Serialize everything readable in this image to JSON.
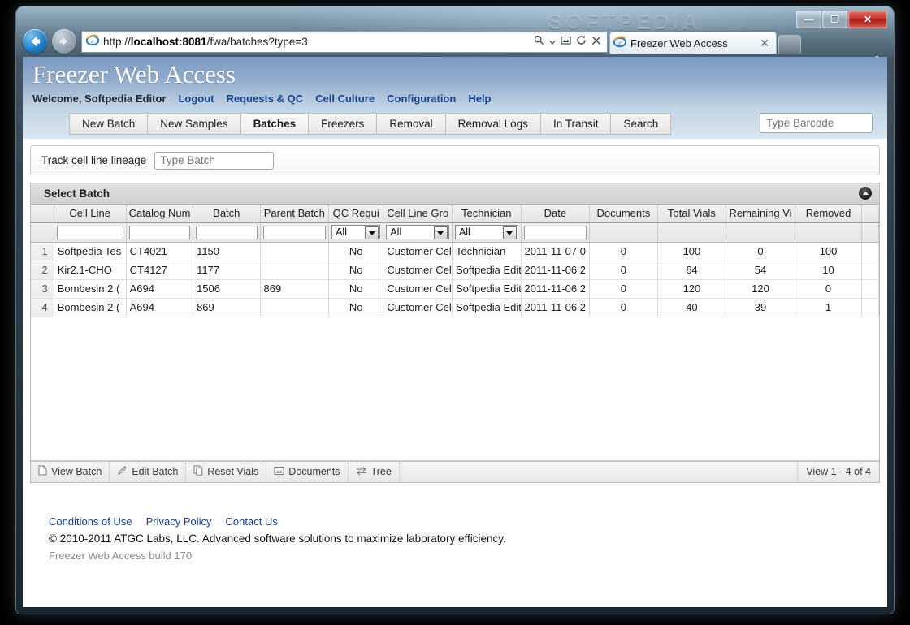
{
  "browser": {
    "url_prefix": "http://",
    "url_host": "localhost:8081",
    "url_path": "/fwa/batches?type=3",
    "watermark": "SOFTPEDIA",
    "tab_title": "Freezer Web Access",
    "tab_close": "✕",
    "minimize": "—",
    "maximize": "❐",
    "close": "✕",
    "icons": {
      "back": "back-arrow-icon",
      "forward": "forward-arrow-icon",
      "ie_logo": "ie-logo-icon",
      "search": "search-icon",
      "dropdown": "chevron-down-icon",
      "compat": "compatibility-view-icon",
      "refresh": "refresh-icon",
      "stop": "stop-icon",
      "home": "home-icon",
      "favorites": "star-icon",
      "tools": "gear-icon"
    }
  },
  "app": {
    "title": "Freezer Web Access",
    "welcome": "Welcome, Softpedia Editor",
    "nav_links": [
      "Logout",
      "Requests & QC",
      "Cell Culture",
      "Configuration",
      "Help"
    ],
    "tabs": [
      {
        "label": "New Batch",
        "active": false
      },
      {
        "label": "New Samples",
        "active": false
      },
      {
        "label": "Batches",
        "active": true
      },
      {
        "label": "Freezers",
        "active": false
      },
      {
        "label": "Removal",
        "active": false
      },
      {
        "label": "Removal Logs",
        "active": false
      },
      {
        "label": "In Transit",
        "active": false
      },
      {
        "label": "Search",
        "active": false
      }
    ],
    "barcode_placeholder": "Type Barcode",
    "lineage_label": "Track cell line lineage",
    "lineage_placeholder": "Type Batch"
  },
  "panel": {
    "title": "Select Batch",
    "collapse_icon": "chevron-up-icon"
  },
  "grid": {
    "columns": [
      "Cell Line",
      "Catalog Num",
      "Batch",
      "Parent Batch",
      "QC Requi",
      "Cell Line Gro",
      "Technician",
      "Date",
      "Documents",
      "Total Vials",
      "Remaining Vi",
      "Removed"
    ],
    "filters": [
      {
        "type": "text",
        "value": ""
      },
      {
        "type": "text",
        "value": ""
      },
      {
        "type": "text",
        "value": ""
      },
      {
        "type": "text",
        "value": ""
      },
      {
        "type": "select",
        "value": "All"
      },
      {
        "type": "select",
        "value": "All"
      },
      {
        "type": "select",
        "value": "All"
      },
      {
        "type": "text",
        "value": ""
      },
      {
        "type": "none",
        "value": ""
      },
      {
        "type": "none",
        "value": ""
      },
      {
        "type": "none",
        "value": ""
      },
      {
        "type": "none",
        "value": ""
      }
    ],
    "rows": [
      {
        "num": "1",
        "cells": [
          "Softpedia Tes",
          "CT4021",
          "1150",
          "",
          "No",
          "Customer Cell",
          "Technician",
          "2011-11-07 0",
          "0",
          "100",
          "0",
          "100"
        ]
      },
      {
        "num": "2",
        "cells": [
          "Kir2.1-CHO",
          "CT4127",
          "1177",
          "",
          "No",
          "Customer Cell",
          "Softpedia Edit",
          "2011-11-06 2",
          "0",
          "64",
          "54",
          "10"
        ]
      },
      {
        "num": "3",
        "cells": [
          "Bombesin 2 (",
          "A694",
          "1506",
          "869",
          "No",
          "Customer Cell",
          "Softpedia Edit",
          "2011-11-06 2",
          "0",
          "120",
          "120",
          "0"
        ]
      },
      {
        "num": "4",
        "cells": [
          "Bombesin 2 (",
          "A694",
          "869",
          "",
          "No",
          "Customer Cell",
          "Softpedia Edit",
          "2011-11-06 2",
          "0",
          "40",
          "39",
          "1"
        ]
      }
    ],
    "toolbar": [
      {
        "label": "View Batch",
        "icon": "document-icon"
      },
      {
        "label": "Edit Batch",
        "icon": "pencil-icon"
      },
      {
        "label": "Reset Vials",
        "icon": "copy-icon"
      },
      {
        "label": "Documents",
        "icon": "image-icon"
      },
      {
        "label": "Tree",
        "icon": "tree-arrows-icon"
      }
    ],
    "view_count": "View 1 - 4 of 4"
  },
  "footer": {
    "links": [
      "Conditions of Use",
      "Privacy Policy",
      "Contact Us"
    ],
    "copyright": "© 2010-2011 ATGC Labs, LLC. Advanced software solutions to maximize laboratory efficiency.",
    "build": "Freezer Web Access build 170"
  }
}
